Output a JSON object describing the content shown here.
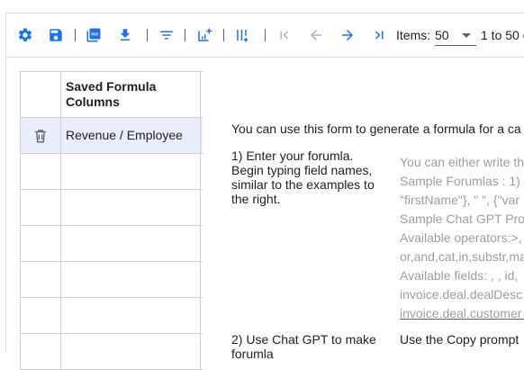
{
  "toolbar": {
    "items_label": "Items:",
    "items_per_page": "50",
    "range_text": "1 to 50 o"
  },
  "grid": {
    "header": "Saved Formula Columns",
    "rows": [
      "Revenue / Employee",
      "",
      "",
      "",
      "",
      "",
      ""
    ]
  },
  "form": {
    "intro": "You can use this form to generate a formula for a ca",
    "step1": "1) Enter your forumla. Begin typing field names, similar to the examples to the right.",
    "step2": "2) Use Chat GPT to make forumla",
    "helper_lines": [
      "You can either write th",
      "Sample Forumlas : 1)",
      "\"firstName\"}, \" \", {\"var",
      "Sample Chat GPT Pro",
      "Available operators:>,",
      "or,and,cat,in,substr,ma",
      "Available fields: , , id,",
      "invoice.deal.dealDesc",
      "invoice.deal.customer"
    ],
    "copy_hint": "Use the Copy prompt"
  },
  "colors": {
    "accent": "#1a73e8",
    "selected_row": "#e8eefc",
    "placeholder": "#9e9e9e"
  }
}
